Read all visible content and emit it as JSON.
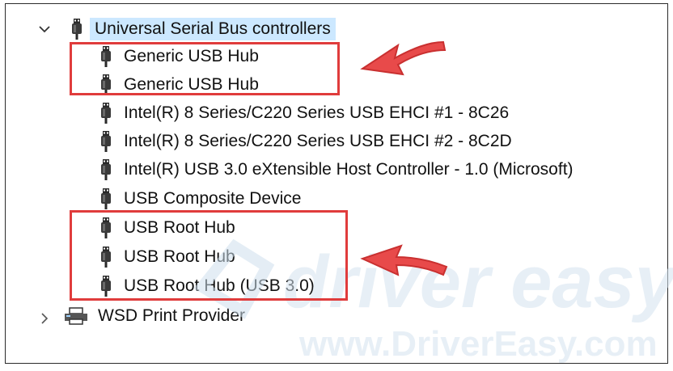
{
  "tree": {
    "category": {
      "label": "Universal Serial Bus controllers",
      "expanded": true,
      "icon": "usb-connector-icon"
    },
    "devices": [
      {
        "label": "Generic USB Hub",
        "icon": "usb-connector-icon"
      },
      {
        "label": "Generic USB Hub",
        "icon": "usb-connector-icon"
      },
      {
        "label": "Intel(R) 8 Series/C220 Series USB EHCI #1 - 8C26",
        "icon": "usb-connector-icon"
      },
      {
        "label": "Intel(R) 8 Series/C220 Series USB EHCI #2 - 8C2D",
        "icon": "usb-connector-icon"
      },
      {
        "label": "Intel(R) USB 3.0 eXtensible Host Controller - 1.0 (Microsoft)",
        "icon": "usb-connector-icon"
      },
      {
        "label": "USB Composite Device",
        "icon": "usb-connector-icon"
      },
      {
        "label": "USB Root Hub",
        "icon": "usb-connector-icon"
      },
      {
        "label": "USB Root Hub",
        "icon": "usb-connector-icon"
      },
      {
        "label": "USB Root Hub (USB 3.0)",
        "icon": "usb-connector-icon"
      }
    ],
    "next_category": {
      "label": "WSD Print Provider",
      "expanded": false,
      "icon": "printer-icon"
    }
  },
  "watermark": {
    "brand": "driver easy",
    "url": "www.DriverEasy.com"
  },
  "colors": {
    "highlight": "#e03c3c",
    "selection": "#cce8ff",
    "watermark": "#d9e6f0"
  }
}
